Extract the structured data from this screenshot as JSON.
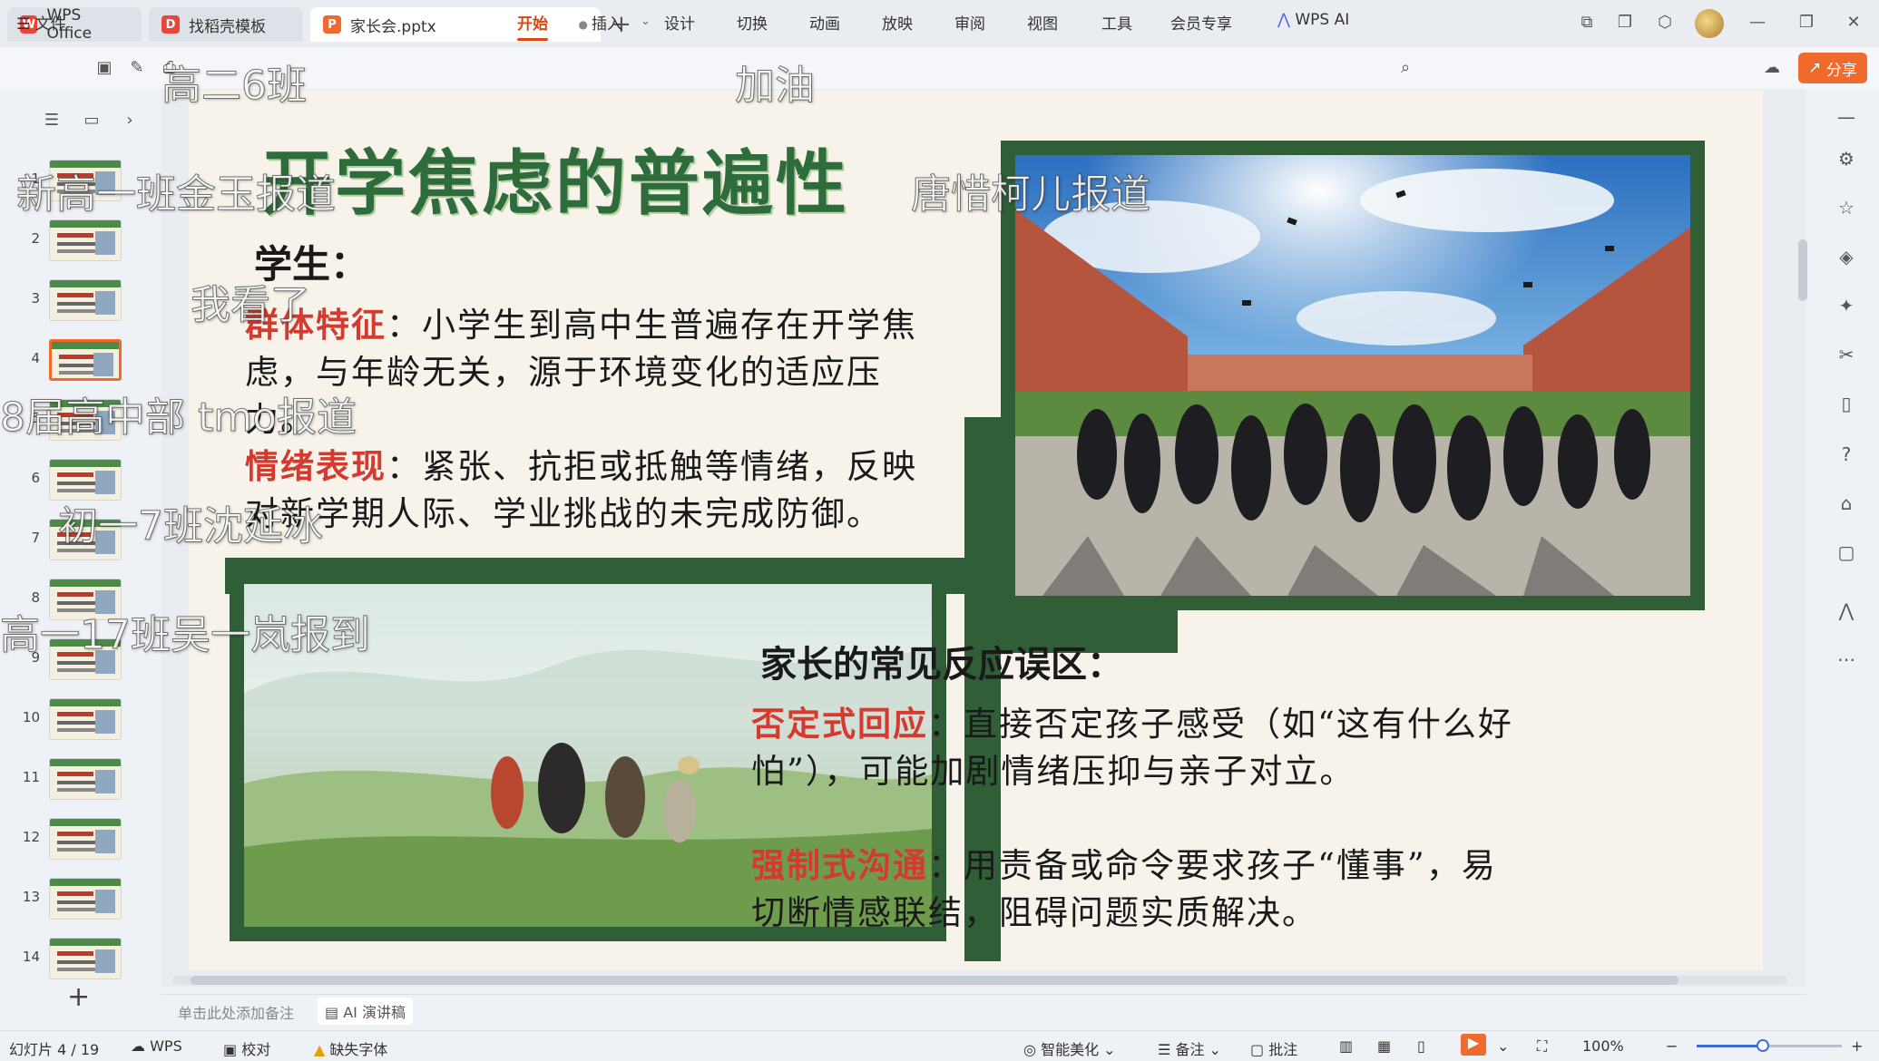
{
  "tabs": [
    {
      "label": "WPS Office",
      "icon": "wps-logo-icon",
      "color": "#e8453c"
    },
    {
      "label": "找稻壳模板",
      "icon": "docer-icon",
      "color": "#e8453c"
    },
    {
      "label": "家长会.pptx",
      "icon": "ppt-file-icon",
      "color": "#ef6a2c"
    }
  ],
  "menu": {
    "file": "文件",
    "items": [
      "开始",
      "插入",
      "设计",
      "切换",
      "动画",
      "放映",
      "审阅",
      "视图",
      "工具",
      "会员专享",
      "WPS AI"
    ],
    "active": "开始",
    "share": "分享"
  },
  "thumbnails": {
    "numbers": [
      "1",
      "2",
      "3",
      "4",
      "5",
      "6",
      "7",
      "8",
      "9",
      "10",
      "11",
      "12",
      "13",
      "14"
    ],
    "active_index": 3
  },
  "slide": {
    "title": "开学焦虑的普遍性",
    "student_head": "学生：",
    "student_items": [
      {
        "label": "群体特征",
        "text": "：小学生到高中生普遍存在开学焦虑，与年龄无关，源于环境变化的适应压力。"
      },
      {
        "label": "情绪表现",
        "text": "：紧张、抗拒或抵触等情绪，反映对新学期人际、学业挑战的未完成防御。"
      }
    ],
    "parent_head": "家长的常见反应误区：",
    "parent_items": [
      {
        "label": "否定式回应",
        "text": "：直接否定孩子感受（如“这有什么好怕”），可能加剧情绪压抑与亲子对立。"
      },
      {
        "label": "强制式沟通",
        "text": "：用责备或命令要求孩子“懂事”，易切断情感联结，阻碍问题实质解决。"
      }
    ]
  },
  "notes": {
    "placeholder": "单击此处添加备注",
    "ai": "AI 演讲稿"
  },
  "status": {
    "slide_counter": "幻灯片 4 / 19",
    "wps": "WPS",
    "proof": "校对",
    "missing_font": "缺失字体",
    "beautify": "智能美化",
    "notes": "备注",
    "comment": "批注",
    "zoom": "100%"
  },
  "danmaku": [
    "高二6班",
    "加油",
    "新高一班金玉报道",
    "唐惜柯儿报道",
    "我看了",
    "8届高中部 tmo报道",
    "初一7班沈延冰",
    "高一17班吴一岚报到"
  ],
  "colors": {
    "accent": "#ef6a2c",
    "slide_green": "#2f5e37",
    "label_red": "#d43a2e"
  }
}
